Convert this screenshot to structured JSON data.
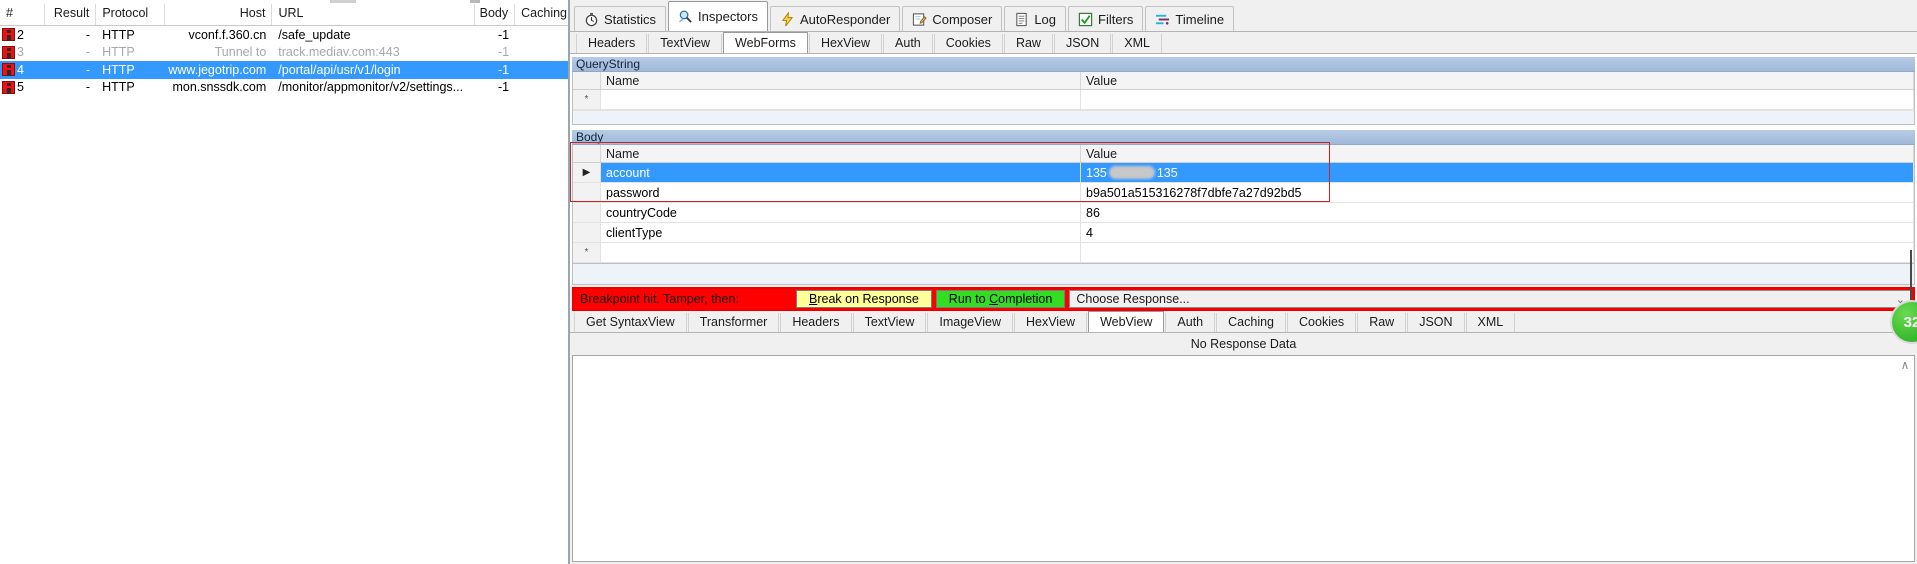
{
  "sessions": {
    "columns": [
      "#",
      "Result",
      "Protocol",
      "Host",
      "URL",
      "Body",
      "Caching"
    ],
    "rows": [
      {
        "num": "2",
        "result": "-",
        "protocol": "HTTP",
        "host": "vconf.f.360.cn",
        "url": "/safe_update",
        "body": "-1",
        "caching": "",
        "state": "normal"
      },
      {
        "num": "3",
        "result": "-",
        "protocol": "HTTP",
        "host": "Tunnel to",
        "url": "track.mediav.com:443",
        "body": "-1",
        "caching": "",
        "state": "dim"
      },
      {
        "num": "4",
        "result": "-",
        "protocol": "HTTP",
        "host": "www.jegotrip.com",
        "url": "/portal/api/usr/v1/login",
        "body": "-1",
        "caching": "",
        "state": "selected"
      },
      {
        "num": "5",
        "result": "-",
        "protocol": "HTTP",
        "host": "mon.snssdk.com",
        "url": "/monitor/appmonitor/v2/settings...",
        "body": "-1",
        "caching": "",
        "state": "normal"
      }
    ]
  },
  "main_tabs": [
    {
      "label": "Statistics",
      "icon": "stopwatch-icon",
      "active": false
    },
    {
      "label": "Inspectors",
      "icon": "magnifier-icon",
      "active": true
    },
    {
      "label": "AutoResponder",
      "icon": "lightning-icon",
      "active": false
    },
    {
      "label": "Composer",
      "icon": "pencil-pad-icon",
      "active": false
    },
    {
      "label": "Log",
      "icon": "list-icon",
      "active": false
    },
    {
      "label": "Filters",
      "icon": "checkbox-icon",
      "active": false
    },
    {
      "label": "Timeline",
      "icon": "timeline-icon",
      "active": false
    }
  ],
  "request_tabs": [
    {
      "label": "Headers",
      "active": false
    },
    {
      "label": "TextView",
      "active": false
    },
    {
      "label": "WebForms",
      "active": true
    },
    {
      "label": "HexView",
      "active": false
    },
    {
      "label": "Auth",
      "active": false
    },
    {
      "label": "Cookies",
      "active": false
    },
    {
      "label": "Raw",
      "active": false
    },
    {
      "label": "JSON",
      "active": false
    },
    {
      "label": "XML",
      "active": false
    }
  ],
  "querystring": {
    "title": "QueryString",
    "headers": {
      "name": "Name",
      "value": "Value"
    },
    "rows": [],
    "new_row_marker": "*"
  },
  "body": {
    "title": "Body",
    "headers": {
      "name": "Name",
      "value": "Value"
    },
    "rows": [
      {
        "marker": "▶",
        "name": "account",
        "value": "135",
        "value_suffix": "135",
        "redacted": true,
        "selected": true
      },
      {
        "marker": "",
        "name": "password",
        "value": "b9a501a515316278f7dbfe7a27d92bd5",
        "value_suffix": "",
        "redacted": false,
        "selected": false
      },
      {
        "marker": "",
        "name": "countryCode",
        "value": "86",
        "value_suffix": "",
        "redacted": false,
        "selected": false
      },
      {
        "marker": "",
        "name": "clientType",
        "value": "4",
        "value_suffix": "",
        "redacted": false,
        "selected": false
      }
    ],
    "new_row_marker": "*"
  },
  "breakpoint": {
    "message": "Breakpoint hit. Tamper, then:",
    "break_on_response": "Break on Response",
    "break_on_response_accel": "B",
    "run_to_completion": "Run to Completion",
    "run_to_completion_accel": "C",
    "choose_response": "Choose Response...",
    "chevron": "⌄",
    "bar_color": "#ff0000",
    "yellow_button_color": "#ffff99",
    "green_button_color": "#33dd22"
  },
  "response_tabs": [
    {
      "label": "Get SyntaxView",
      "active": false
    },
    {
      "label": "Transformer",
      "active": false
    },
    {
      "label": "Headers",
      "active": false
    },
    {
      "label": "TextView",
      "active": false
    },
    {
      "label": "ImageView",
      "active": false
    },
    {
      "label": "HexView",
      "active": false
    },
    {
      "label": "WebView",
      "active": true
    },
    {
      "label": "Auth",
      "active": false
    },
    {
      "label": "Caching",
      "active": false
    },
    {
      "label": "Cookies",
      "active": false
    },
    {
      "label": "Raw",
      "active": false
    },
    {
      "label": "JSON",
      "active": false
    },
    {
      "label": "XML",
      "active": false
    }
  ],
  "response": {
    "no_data_message": "No Response Data",
    "scroll_up_glyph": "∧"
  },
  "badge": {
    "count": "32",
    "color": "#34b92c"
  },
  "colors": {
    "selection_blue": "#3399ff",
    "group_header_blue": "#9fb9d8",
    "breakpoint_red": "#ff0000",
    "highlight_box_red": "#cc2222"
  }
}
